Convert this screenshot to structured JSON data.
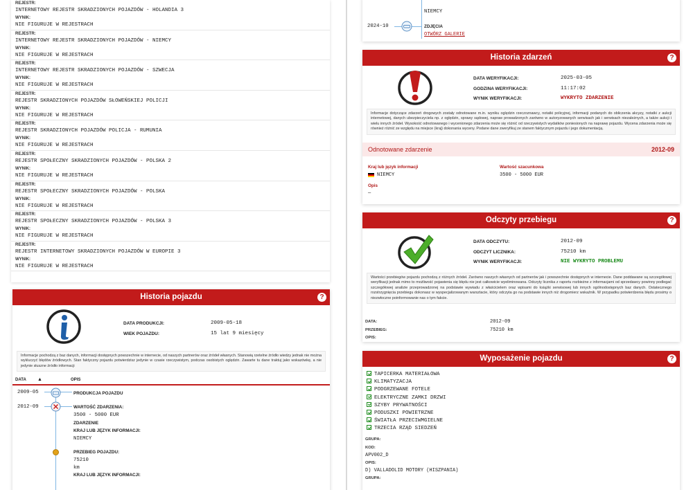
{
  "registers": [
    {
      "label": "REJESTR:",
      "name": "INTERNETOWY REJESTR SKRADZIONYCH POJAZDÓW - HOLANDIA 3",
      "result_label": "WYNIK:",
      "result": "NIE FIGURUJE W REJESTRACH"
    },
    {
      "label": "REJESTR:",
      "name": "INTERNETOWY REJESTR SKRADZIONYCH POJAZDÓW - NIEMCY",
      "result_label": "WYNIK:",
      "result": "NIE FIGURUJE W REJESTRACH"
    },
    {
      "label": "REJESTR:",
      "name": "INTERNETOWY REJESTR SKRADZIONYCH POJAZDÓW - SZWECJA",
      "result_label": "WYNIK:",
      "result": "NIE FIGURUJE W REJESTRACH"
    },
    {
      "label": "REJESTR:",
      "name": "REJESTR SKRADZIONYCH POJAZDÓW SŁOWEŃSKIEJ POLICJI",
      "result_label": "WYNIK:",
      "result": "NIE FIGURUJE W REJESTRACH"
    },
    {
      "label": "REJESTR:",
      "name": "REJESTR SKRADZIONYCH POJAZDÓW POLICJA - RUMUNIA",
      "result_label": "WYNIK:",
      "result": "NIE FIGURUJE W REJESTRACH"
    },
    {
      "label": "REJESTR:",
      "name": "REJESTR SPOŁECZNY SKRADZIONYCH POJAZDÓW - POLSKA 2",
      "result_label": "WYNIK:",
      "result": "NIE FIGURUJE W REJESTRACH"
    },
    {
      "label": "REJESTR:",
      "name": "REJESTR SPOŁECZNY SKRADZIONYCH POJAZDÓW - POLSKA",
      "result_label": "WYNIK:",
      "result": "NIE FIGURUJE W REJESTRACH"
    },
    {
      "label": "REJESTR:",
      "name": "REJESTR SPOŁECZNY SKRADZIONYCH POJAZDÓW - POLSKA 3",
      "result_label": "WYNIK:",
      "result": "NIE FIGURUJE W REJESTRACH"
    },
    {
      "label": "REJESTR:",
      "name": "REJESTR INTERNETOWY SKRADZIONYCH POJAZDÓW W EUROPIE 3",
      "result_label": "WYNIK:",
      "result": "NIE FIGURUJE W REJESTRACH"
    }
  ],
  "history": {
    "title": "Historia pojazdu",
    "help": "?",
    "production_date_label": "DATA PRODUKCJI:",
    "production_date": "2009-05-18",
    "age_label": "WIEK POJAZDU:",
    "age": "15 lat 9 miesięcy",
    "notice": "Informacje pochodzą z baz danych, informacji dostępnych powszechnie w internecie, od naszych partnerów oraz źródeł własnych. Stanowią rzetelne źródło wiedzy jednak nie można wykluczyć błędów źródłowych. Stan faktyczny pojazdu potwierdzisz jedynie w czasie rzeczywistym, podczas osobistych oględzin. Zawarte tu dane traktuj jako wskazówkę, a nie jedynie słuszne źródło informacji",
    "col_date": "DATA",
    "col_desc": "OPIS",
    "sort_icon": "▲",
    "events": [
      {
        "date": "2009-05",
        "title": "PRODUKCJA POJAZDU"
      },
      {
        "date": "2012-09",
        "title": "WARTOŚĆ ZDARZENIA:",
        "value": "3500 - 5000 EUR",
        "sub1": "ZDARZENIE",
        "sub2": "KRAJ LUB JĘZYK INFORMACJI:",
        "sub2_value": "NIEMCY"
      },
      {
        "title": "PRZEBIEG POJAZDU:",
        "value": "75210",
        "unit": "km",
        "sub": "KRAJ LUB JĘZYK INFORMACJI:"
      }
    ]
  },
  "top_right": {
    "country": "NIEMCY",
    "date": "2024-10",
    "photos_label": "ZDJĘCIA",
    "gallery_link": "OTWÓRZ GALERIĘ"
  },
  "incidents": {
    "title": "Historia zdarzeń",
    "help": "?",
    "verify_date_label": "DATA WERYFIKACJI:",
    "verify_date": "2025-03-05",
    "verify_time_label": "GODZINA WERYFIKACJI:",
    "verify_time": "11:17:02",
    "verify_result_label": "WYNIK WERYFIKACJI:",
    "verify_result": "WYKRYTO ZDARZENIE",
    "notice": "Informacje dotyczące zdarzeń drogowych zostały odnotowane m.in. wyniku oględzin rzeczoznawcy, notatki policyjnej, informacji podanych do obliczenia akcyzy, notatki z aukcji internetowej, danych ubezpieczyciela np. z oględzin, sprawy sądowej, napraw prowadzonych zarówno w autoryzowanych serwisach jak i serwisach niezależnych, a także aukcji i wielu innych źródeł. Wysokość odnotowanego i wycenionego zdarzenia może się różnić od rzeczywistych wydatków poniesionych na naprawę pojazdu. Wycena zdarzenia może się również różnić ze względu na miejsce (kraj) dokonania wyceny. Podane dane zweryfikuj ze stanem faktycznym pojazdu i jego dokumentacją.",
    "event_title": "Odnotowane zdarzenie",
    "event_date": "2012-09",
    "country_label": "Kraj lub język informacji",
    "country": "NIEMCY",
    "value_label": "Wartość szacunkowa",
    "value": "3500 - 5000 EUR",
    "desc_label": "Opis",
    "desc": "—"
  },
  "mileage": {
    "title": "Odczyty przebiegu",
    "help": "?",
    "read_date_label": "DATA ODCZYTU:",
    "read_date": "2012-09",
    "odometer_label": "ODCZYT LICZNIKA:",
    "odometer": "75210 km",
    "verify_result_label": "WYNIK WERYFIKACJI:",
    "verify_result": "NIE WYKRYTO PROBLEMU",
    "notice": "Wartości przebiegów pojazdu pochodzą z różnych źródeł. Zarówno naszych własnych od partnerów jak i powszechnie dostępnych w internecie. Dane poddawane są szczegółowej weryfikacji jednak mimo to możliwość pojawienia się błędu nie jest całkowicie wyeliminowana. Odczyty licznika z raportu rozbieżne z informacjami od sprzedawcy powinny podlegać szczegółowej analizie przeprowadzonej na podstawie wywiadu z właścicielem oraz wpisami do książki serwisowej lub innych ogólnodostępnych baz danych. Ostatecznego rozstrzygnięcia przebiegu dokonasz w wyspecjalizowanym warsztacie, który odczyta go na podstawie innych niż drogomierz wskaźnik. W przypadku potwierdzenia błędu prosimy o niezwłoczne poinformowanie nas o tym fakcie.",
    "date_label": "DATA:",
    "date": "2012-09",
    "mileage_label": "PRZEBIEG:",
    "mileage": "75210 km",
    "desc_label": "OPIS:"
  },
  "equipment": {
    "title": "Wyposażenie pojazdu",
    "help": "?",
    "items": [
      "TAPICERKA MATERIAŁOWA",
      "KLIMATYZACJA",
      "PODGRZEWANE FOTELE",
      "ELEKTRYCZNE ZAMKI DRZWI",
      "SZYBY PRYWATNOŚCI",
      "PODUSZKI POWIETRZNE",
      "ŚWIATŁA PRZECIWMGIELNE",
      "TRZECIA RZĄD SIEDZEŃ"
    ],
    "group_label": "GRUPA:",
    "code_label": "KOD:",
    "code": "APV002_D",
    "desc_label": "OPIS:",
    "desc": "D) VALLADOLID MOTORY (HISZPANIA)",
    "group_label2": "GRUPA:"
  },
  "colors": {
    "brand_red": "#c21b1b",
    "alert_red": "#b01818",
    "ok_green": "#1a8a1a"
  }
}
